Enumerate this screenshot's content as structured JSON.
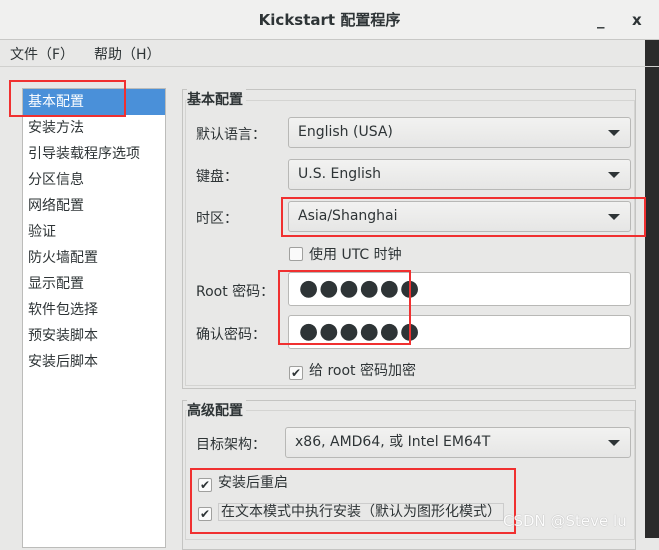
{
  "window": {
    "title": "Kickstart 配置程序",
    "minimize": "_",
    "close": "x"
  },
  "menu": [
    "文件（F）",
    "帮助（H）"
  ],
  "sidebar": {
    "items": [
      "基本配置",
      "安装方法",
      "引导装载程序选项",
      "分区信息",
      "网络配置",
      "验证",
      "防火墙配置",
      "显示配置",
      "软件包选择",
      "预安装脚本",
      "安装后脚本"
    ]
  },
  "basic": {
    "legend": "基本配置",
    "language_label": "默认语言：",
    "language_value": "English (USA)",
    "keyboard_label": "键盘：",
    "keyboard_value": "U.S. English",
    "timezone_label": "时区：",
    "timezone_value": "Asia/Shanghai",
    "utc_label": "使用  UTC 时钟",
    "utc_checked": false,
    "root_label": "Root 密码：",
    "root_value": "●●●●●●",
    "confirm_label": "确认密码：",
    "confirm_value": "●●●●●●",
    "encrypt_label": "给  root 密码加密",
    "encrypt_checked": true
  },
  "advanced": {
    "legend": "高级配置",
    "arch_label": "目标架构：",
    "arch_value": "x86, AMD64, 或  Intel EM64T",
    "reboot_label": "安装后重启",
    "reboot_checked": true,
    "textmode_label": "在文本模式中执行安装（默认为图形化模式）",
    "textmode_checked": true
  },
  "watermark": "CSDN @Steve lu"
}
